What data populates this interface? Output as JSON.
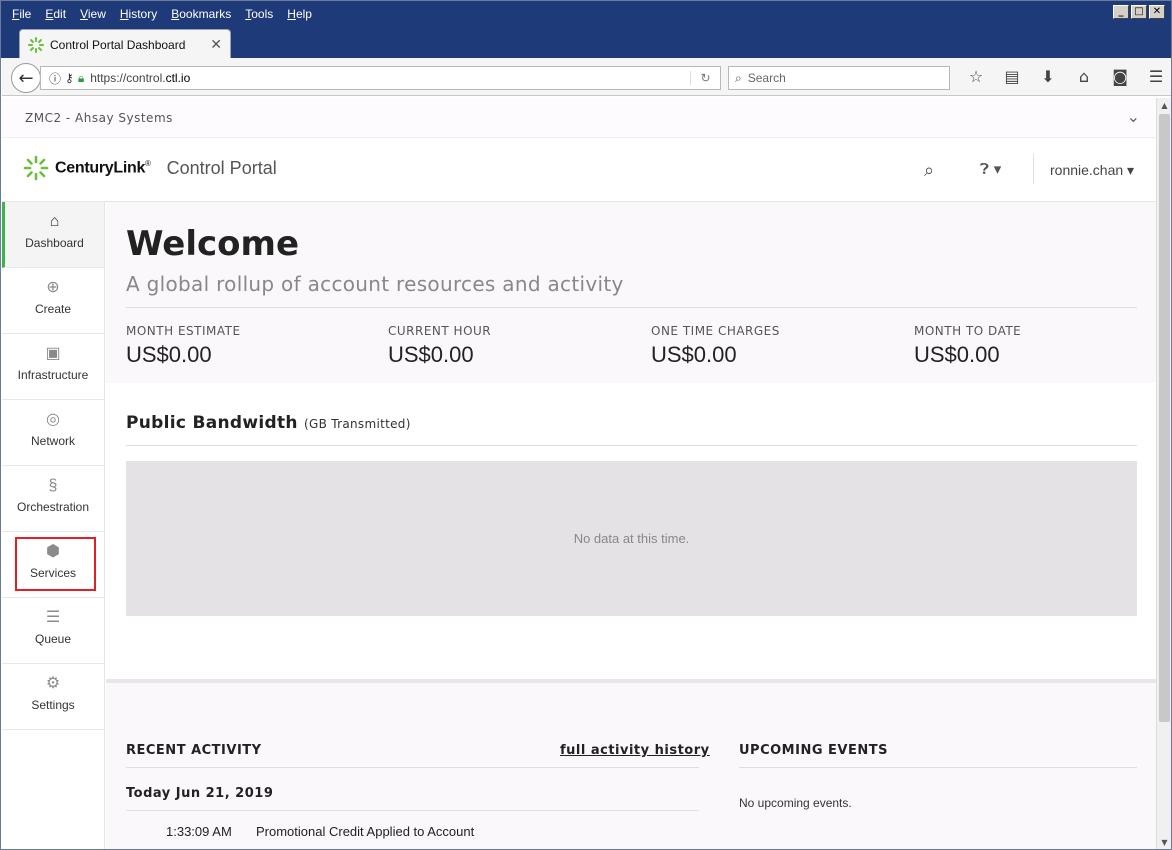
{
  "browser": {
    "menu": [
      "File",
      "Edit",
      "View",
      "History",
      "Bookmarks",
      "Tools",
      "Help"
    ],
    "window_buttons": [
      "_",
      "□",
      "✕"
    ],
    "tab": {
      "title": "Control Portal Dashboard",
      "close": "✕"
    },
    "url_prefix": "https://control.",
    "url_domain": "ctl.io",
    "search_placeholder": "Search"
  },
  "account": {
    "name": "ZMC2 - Ahsay Systems"
  },
  "header": {
    "brand": "CenturyLink",
    "brand_mark": "®",
    "portal": "Control Portal",
    "user": "ronnie.chan"
  },
  "sidebar": {
    "items": [
      {
        "label": "Dashboard",
        "icon": "home-icon"
      },
      {
        "label": "Create",
        "icon": "plus-circle-icon"
      },
      {
        "label": "Infrastructure",
        "icon": "chip-icon"
      },
      {
        "label": "Network",
        "icon": "globe-icon"
      },
      {
        "label": "Orchestration",
        "icon": "orchestration-icon"
      },
      {
        "label": "Services",
        "icon": "cube-icon"
      },
      {
        "label": "Queue",
        "icon": "queue-icon"
      },
      {
        "label": "Settings",
        "icon": "gear-icon"
      }
    ]
  },
  "welcome": {
    "title": "Welcome",
    "subtitle": "A global rollup of account resources and activity",
    "metrics": [
      {
        "label": "MONTH ESTIMATE",
        "value": "US$0.00"
      },
      {
        "label": "CURRENT HOUR",
        "value": "US$0.00"
      },
      {
        "label": "ONE TIME CHARGES",
        "value": "US$0.00"
      },
      {
        "label": "MONTH TO DATE",
        "value": "US$0.00"
      }
    ]
  },
  "bandwidth": {
    "title": "Public Bandwidth",
    "unit": "(GB Transmitted)",
    "empty": "No data at this time."
  },
  "activity": {
    "title": "RECENT ACTIVITY",
    "link": "full activity history",
    "date": "Today Jun 21, 2019",
    "items": [
      {
        "time": "1:33:09 AM",
        "text": "Promotional Credit Applied to Account"
      }
    ]
  },
  "events": {
    "title": "UPCOMING EVENTS",
    "empty": "No upcoming events."
  },
  "colors": {
    "accent_green": "#3db34a",
    "highlight_red": "#e31e24",
    "titlebar": "#1e3a78"
  }
}
